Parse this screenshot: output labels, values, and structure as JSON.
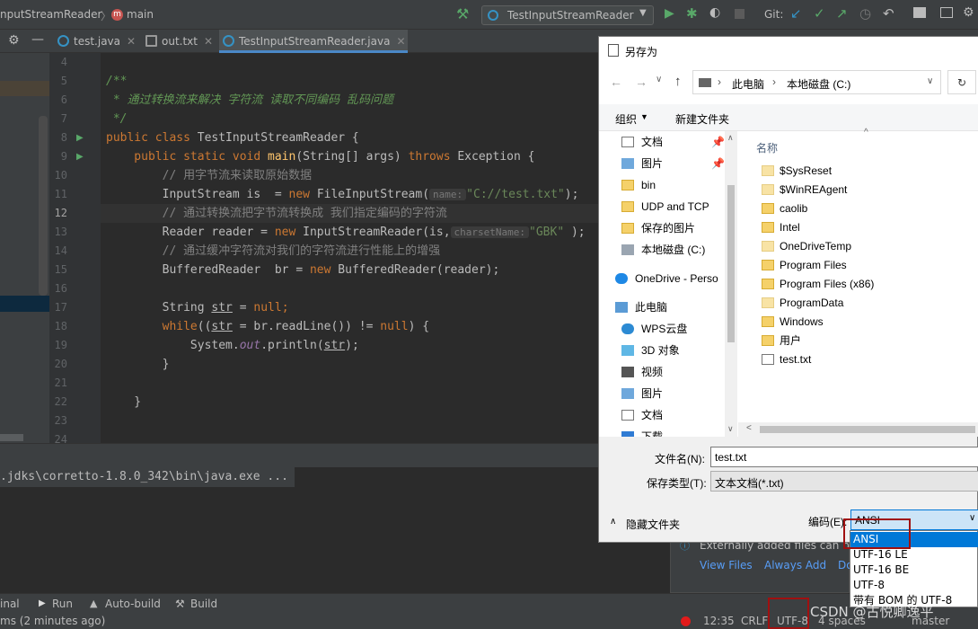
{
  "topbar": {
    "breadcrumb_class": "nputStreamReader",
    "breadcrumb_method": "main",
    "run_config": "TestInputStreamReader",
    "git_label": "Git:"
  },
  "tabs": [
    {
      "label": "test.java",
      "color": "#3592c4"
    },
    {
      "label": "out.txt",
      "color": "#999999"
    },
    {
      "label": "TestInputStreamReader.java",
      "color": "#3592c4"
    }
  ],
  "editor": {
    "line_numbers": [
      "4",
      "5",
      "6",
      "7",
      "8",
      "9",
      "10",
      "11",
      "12",
      "13",
      "14",
      "15",
      "16",
      "17",
      "18",
      "19",
      "20",
      "21",
      "22",
      "23",
      "24"
    ],
    "l5": "/**",
    "l6": " * 通过转换流来解决 字符流 读取不同编码 乱码问题",
    "l7": " */",
    "l8_kw": "public class ",
    "l8_name": "TestInputStreamReader {",
    "l9_a": "    public static void ",
    "l9_fn": "main",
    "l9_b": "(String[] args) ",
    "l9_kw": "throws ",
    "l9_c": "Exception {",
    "l10": "        // 用字节流来读取原始数据",
    "l11_a": "        InputStream is  = ",
    "l11_kw": "new ",
    "l11_b": "FileInputStream(",
    "l11_hint": "name:",
    "l11_str": "\"C://test.txt\"",
    "l11_c": ");",
    "l12": "        // 通过转换流把字节流转换成 我们指定编码的字符流",
    "l13_a": "        Reader reader = ",
    "l13_kw": "new ",
    "l13_b": "InputStreamReader(is,",
    "l13_hint": "charsetName:",
    "l13_str": "\"GBK\"",
    "l13_c": " );",
    "l14": "        // 通过缓冲字符流对我们的字符流进行性能上的增强",
    "l15_a": "        BufferedReader  br = ",
    "l15_kw": "new ",
    "l15_b": "BufferedReader(reader);",
    "l17_a": "        String ",
    "l17_var": "str",
    "l17_b": " = ",
    "l17_kw": "null",
    "l17_c": ";",
    "l18_kw": "        while",
    "l18_a": "((",
    "l18_var": "str",
    "l18_b": " = br.readLine()) != ",
    "l18_kw2": "null",
    "l18_c": ") {",
    "l19_a": "            System.",
    "l19_it": "out",
    "l19_b": ".println(",
    "l19_var": "str",
    "l19_c": ");",
    "l20": "        }",
    "l22": "    }"
  },
  "run": {
    "command": ".jdks\\corretto-1.8.0_342\\bin\\java.exe ..."
  },
  "toolstrip": {
    "terminal": "inal",
    "run": "Run",
    "autobuild": "Auto-build",
    "build": "Build"
  },
  "status": {
    "left": "ms (2 minutes ago)",
    "time": "12:35",
    "crlf": "CRLF",
    "encoding": "UTF-8",
    "indent": "4 spaces",
    "branch": "master"
  },
  "notification": {
    "text": "Externally added files can b",
    "view_files": "View Files",
    "always_add": "Always Add",
    "do": "Do"
  },
  "dialog": {
    "title": "另存为",
    "path_computer": "此电脑",
    "path_disk": "本地磁盘 (C:)",
    "organize": "组织",
    "new_folder": "新建文件夹",
    "col_name": "名称",
    "tree": [
      "文档",
      "图片",
      "bin",
      "UDP and TCP",
      "保存的图片",
      "本地磁盘 (C:)",
      "OneDrive - Perso",
      "此电脑",
      "WPS云盘",
      "3D 对象",
      "视频",
      "图片",
      "文档",
      "下载"
    ],
    "files": [
      "$SysReset",
      "$WinREAgent",
      "caolib",
      "Intel",
      "OneDriveTemp",
      "Program Files",
      "Program Files (x86)",
      "ProgramData",
      "Windows",
      "用户",
      "test.txt"
    ],
    "filename_label": "文件名(N):",
    "filename_value": "test.txt",
    "filetype_label": "保存类型(T):",
    "filetype_value": "文本文档(*.txt)",
    "hide_folders": "隐藏文件夹",
    "encoding_label": "编码(E):",
    "encoding_value": "ANSI",
    "encoding_options": [
      "ANSI",
      "UTF-16 LE",
      "UTF-16 BE",
      "UTF-8",
      "带有 BOM 的 UTF-8"
    ]
  },
  "watermark": "CSDN @古悦卿逸平"
}
